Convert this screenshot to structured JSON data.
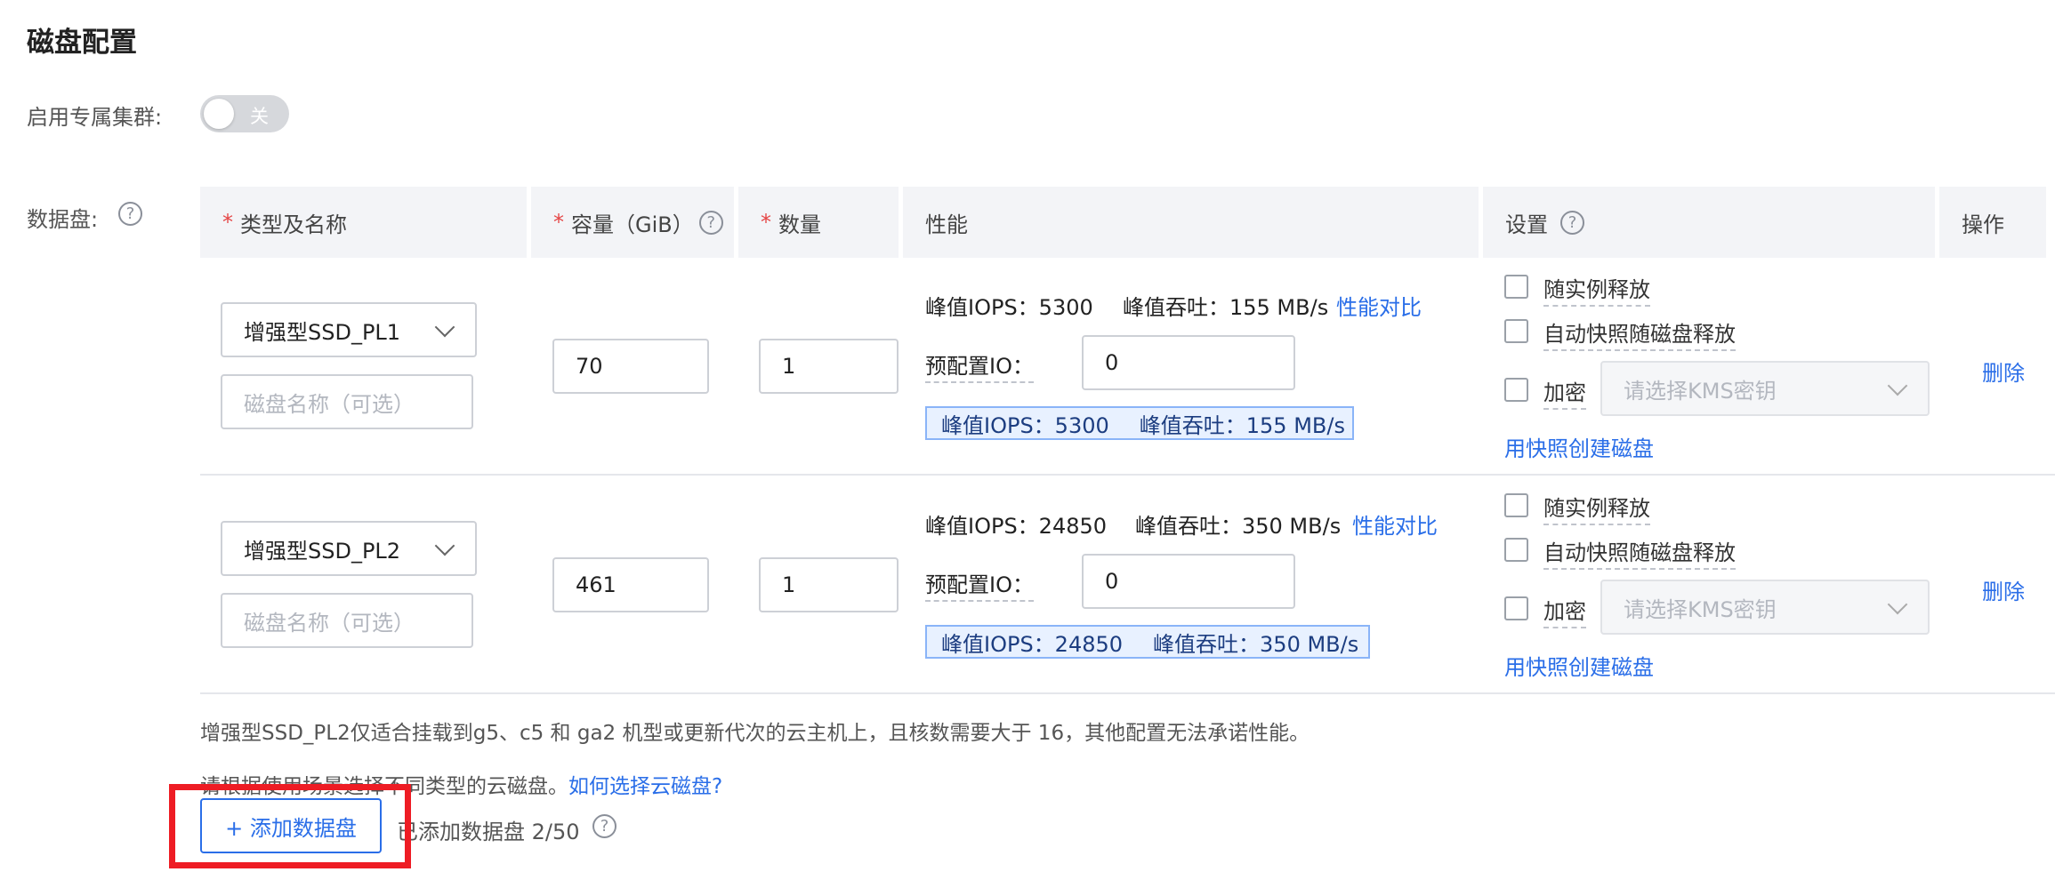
{
  "page": {
    "title": "磁盘配置",
    "dedicated_cluster": {
      "label": "启用专属集群:",
      "switch_text": "关",
      "enabled": false
    }
  },
  "data_disk": {
    "label": "数据盘:",
    "help_icon": "question-circle-icon",
    "columns": {
      "type_name": "类型及名称",
      "capacity": "容量（GiB）",
      "count": "数量",
      "performance": "性能",
      "settings": "设置",
      "actions": "操作"
    },
    "required_mark": "*",
    "rows": [
      {
        "type": "增强型SSD_PL1",
        "name_placeholder": "磁盘名称（可选）",
        "capacity": "70",
        "count": "1",
        "peak_iops": "峰值IOPS：5300",
        "peak_throughput": "峰值吞吐：155 MB/s",
        "compare_link": "性能对比",
        "preconfig_io_label": "预配置IO：",
        "preconfig_io_value": "0",
        "badge_iops": "峰值IOPS：5300",
        "badge_throughput": "峰值吞吐：155 MB/s",
        "release_with_instance": "随实例释放",
        "snapshot_release": "自动快照随磁盘释放",
        "encrypt": "加密",
        "kms_placeholder": "请选择KMS密钥",
        "create_from_snapshot": "用快照创建磁盘",
        "delete": "删除"
      },
      {
        "type": "增强型SSD_PL2",
        "name_placeholder": "磁盘名称（可选）",
        "capacity": "461",
        "count": "1",
        "peak_iops": "峰值IOPS：24850",
        "peak_throughput": "峰值吞吐：350 MB/s",
        "compare_link": "性能对比",
        "preconfig_io_label": "预配置IO：",
        "preconfig_io_value": "0",
        "badge_iops": "峰值IOPS：24850",
        "badge_throughput": "峰值吞吐：350 MB/s",
        "release_with_instance": "随实例释放",
        "snapshot_release": "自动快照随磁盘释放",
        "encrypt": "加密",
        "kms_placeholder": "请选择KMS密钥",
        "create_from_snapshot": "用快照创建磁盘",
        "delete": "删除"
      }
    ],
    "note_pl2": "增强型SSD_PL2仅适合挂载到g5、c5 和 ga2 机型或更新代次的云主机上，且核数需要大于 16，其他配置无法承诺性能。",
    "note_choose": "请根据使用场景选择不同类型的云磁盘。",
    "note_choose_link": "如何选择云磁盘?",
    "add_button": "+ 添加数据盘",
    "added_count": "已添加数据盘 2/50"
  }
}
